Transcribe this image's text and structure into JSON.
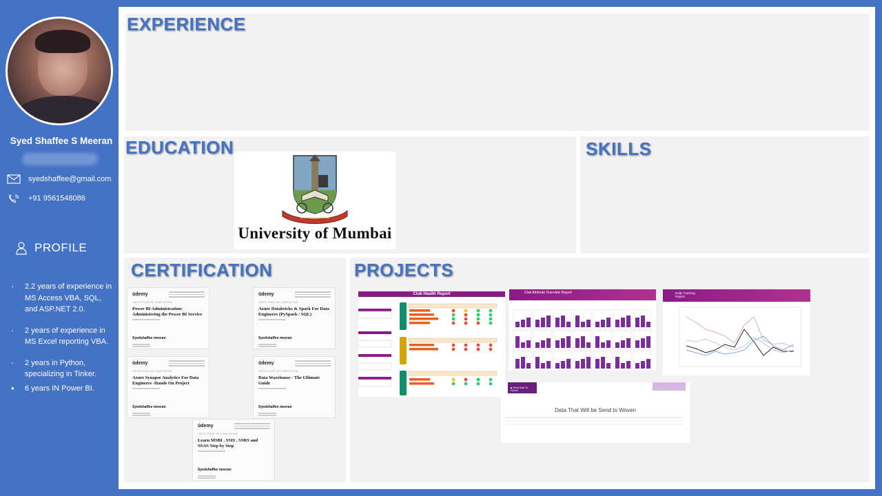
{
  "profile": {
    "name": "Syed Shaffee S Meeran",
    "email": "syedshaffee@gmail.com",
    "phone": "+91 9561548086",
    "section_title": "PROFILE",
    "bullets": [
      "2.2 years of experience in MS Access VBA, SQL, and ASP.NET 2.0.",
      "2 years of experience in MS Excel reporting VBA.",
      "2 years in Python, specializing in Tinker.",
      "6 years IN Power BI."
    ]
  },
  "sections": {
    "experience": "EXPERIENCE",
    "education": "EDUCATION",
    "skills": "SKILLS",
    "certification": "CERTIFICATION",
    "projects": "PROJECTS"
  },
  "education": {
    "institution": "University of Mumbai"
  },
  "certifications": [
    {
      "brand": "ūdemy",
      "title": "Power BI Administration: Administering the Power BI Service",
      "holder": "Syedshaffee meeran"
    },
    {
      "brand": "ūdemy",
      "title": "Azure Databricks & Spark For Data Engineers (PySpark / SQL)",
      "holder": "Syedshaffee meeran"
    },
    {
      "brand": "ūdemy",
      "title": "Azure Synapse Analytics For Data Engineers -Hands On Project",
      "holder": "Syedshaffee meeran"
    },
    {
      "brand": "ūdemy",
      "title": "Data Warehouse - The Ultimate Guide",
      "holder": "Syedshaffee meeran"
    },
    {
      "brand": "ūdemy",
      "title": "Learn MSBI , SSIS , SSRS and SSAS Step by Step",
      "holder": "Syedshaffee meeran"
    }
  ],
  "projects": {
    "club_health": {
      "title": "Club Health Report",
      "kpi_header": "KPIS",
      "months": [
        "April 2022",
        "May 2022",
        "June 2022",
        "July 2022"
      ],
      "row_labels": [
        "Financial",
        "Member",
        "Team"
      ],
      "status_grid": [
        [
          "red",
          "yellow",
          "green",
          "green"
        ],
        [
          "green",
          "red",
          "green",
          "green"
        ],
        [
          "green",
          "red",
          "green",
          "green"
        ],
        [
          "red",
          "red",
          "red",
          "green"
        ],
        [
          "red",
          "red",
          "red",
          "red"
        ],
        [
          "red",
          "red",
          "red",
          "red"
        ],
        [
          "yellow",
          "red",
          "green",
          "green"
        ],
        [
          "green",
          "green",
          "green",
          "green"
        ]
      ]
    },
    "club_attribute": {
      "title": "Club Attribute Overview Report"
    },
    "daily_tracking": {
      "title": "Daily Tracking Report"
    },
    "woven": {
      "title": "Data That Will be Send to Woven"
    }
  },
  "colors": {
    "accent": "#4472c4",
    "purple": "#8b1a86",
    "status_green": "#2ecc71",
    "status_red": "#e74c3c",
    "status_yellow": "#f1c40f"
  }
}
